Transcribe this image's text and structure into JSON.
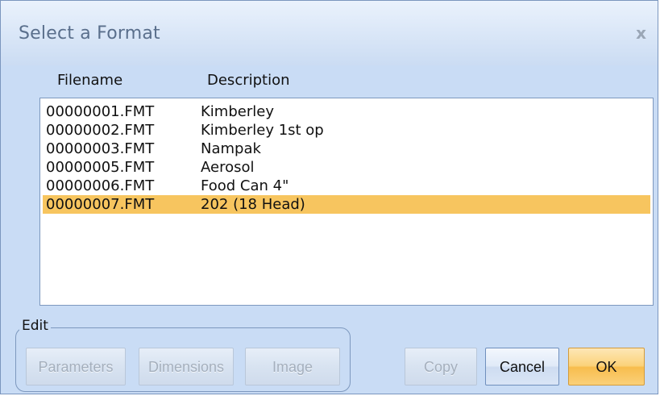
{
  "window": {
    "title": "Select a Format",
    "close_label": "x"
  },
  "columns": {
    "filename": "Filename",
    "description": "Description"
  },
  "rows": [
    {
      "filename": "00000001.FMT",
      "description": "Kimberley",
      "selected": false
    },
    {
      "filename": "00000002.FMT",
      "description": "Kimberley 1st op",
      "selected": false
    },
    {
      "filename": "00000003.FMT",
      "description": "Nampak",
      "selected": false
    },
    {
      "filename": "00000005.FMT",
      "description": "Aerosol",
      "selected": false
    },
    {
      "filename": "00000006.FMT",
      "description": "Food Can 4\"",
      "selected": false
    },
    {
      "filename": "00000007.FMT",
      "description": "202 (18 Head)",
      "selected": true
    }
  ],
  "edit_group": {
    "label": "Edit",
    "parameters_label": "Parameters",
    "dimensions_label": "Dimensions",
    "image_label": "Image"
  },
  "buttons": {
    "copy_label": "Copy",
    "cancel_label": "Cancel",
    "ok_label": "OK"
  },
  "colors": {
    "dialog_background": "#c9dcf5",
    "selection": "#f7c55f",
    "ok_button": "#fbd27a"
  }
}
